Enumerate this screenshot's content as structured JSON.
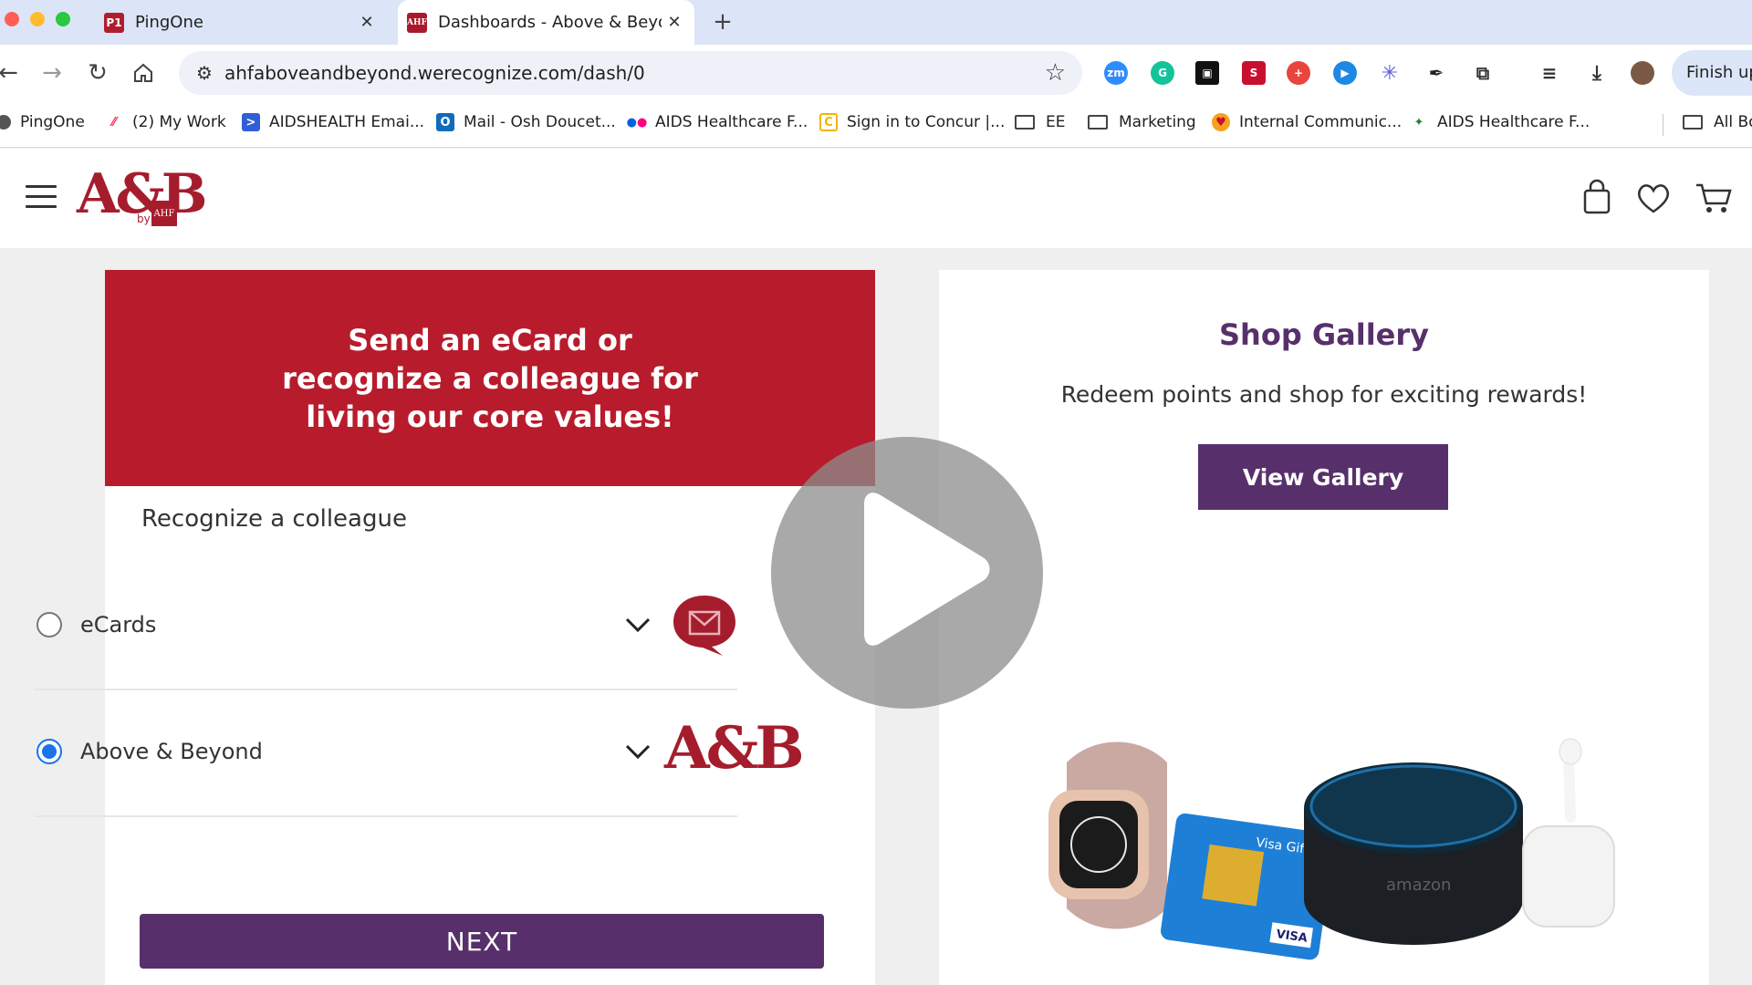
{
  "browser": {
    "tabs": [
      {
        "favicon": "P1",
        "title": "PingOne",
        "active": false
      },
      {
        "favicon": "AHF",
        "title": "Dashboards - Above & Beyond",
        "active": true
      }
    ],
    "url": "ahfaboveandbeyond.werecognize.com/dash/0",
    "finish_label": "Finish up",
    "bookmarks": [
      {
        "label": "PingOne",
        "icon": "pingone-icon"
      },
      {
        "label": "(2) My Work",
        "icon": "monday-icon"
      },
      {
        "label": "AIDSHEALTH Emai...",
        "icon": "email-icon"
      },
      {
        "label": "Mail - Osh Doucet...",
        "icon": "outlook-icon"
      },
      {
        "label": "AIDS Healthcare F...",
        "icon": "flickr-icon"
      },
      {
        "label": "Sign in to Concur |...",
        "icon": "concur-icon"
      },
      {
        "label": "EE",
        "icon": "folder-icon"
      },
      {
        "label": "Marketing",
        "icon": "folder-icon"
      },
      {
        "label": "Internal Communic...",
        "icon": "comm-icon"
      },
      {
        "label": "AIDS Healthcare F...",
        "icon": "ahf-icon"
      },
      {
        "label": "All Bookmarks",
        "icon": "folder-icon"
      }
    ]
  },
  "site": {
    "logo": {
      "letters": "A&B",
      "by": "by",
      "badge": "AHF"
    }
  },
  "left_card": {
    "banner": "Send an eCard or recognize a colleague for living our core values!",
    "section_label": "Recognize a colleague",
    "options": [
      {
        "label": "eCards",
        "selected": false,
        "icon": "ecard-envelope-icon"
      },
      {
        "label": "Above & Beyond",
        "selected": true,
        "icon": "ab-logo-icon",
        "mark": "A&B"
      }
    ],
    "next_label": "NEXT"
  },
  "right_card": {
    "title": "Shop Gallery",
    "subtitle": "Redeem points and shop for exciting rewards!",
    "button_label": "View Gallery",
    "product_texts": {
      "gift_card": "Visa Gift",
      "card_brand": "VISA",
      "speaker_brand": "amazon"
    }
  },
  "colors": {
    "brand_red": "#b81c2c",
    "brand_purple": "#57306b",
    "radio_blue": "#1a73e8"
  }
}
